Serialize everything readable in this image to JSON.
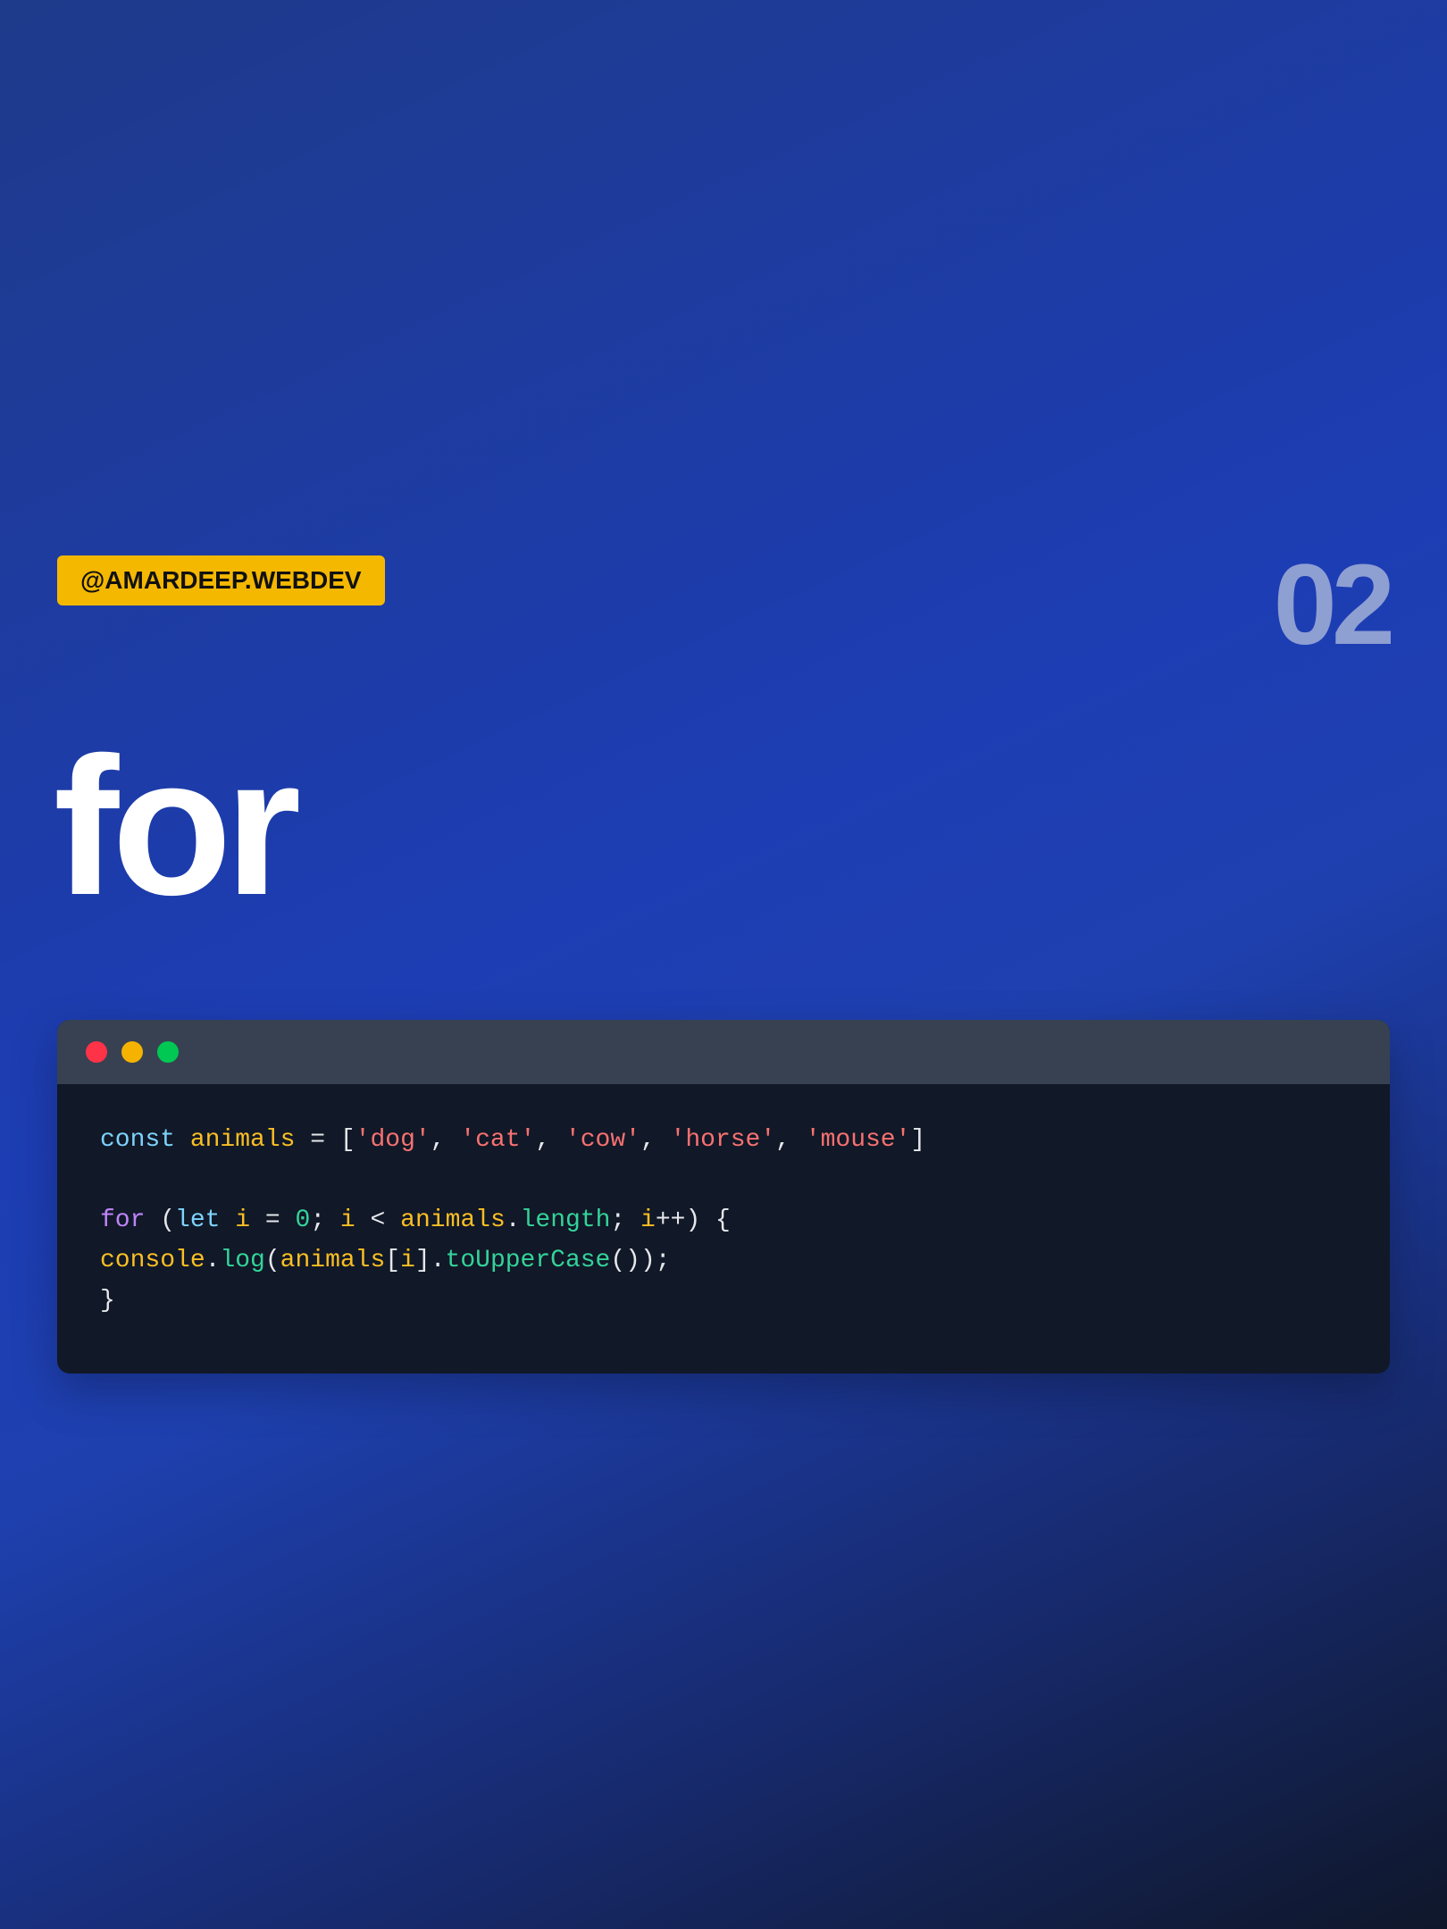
{
  "badge": {
    "label": "@AMARDEEP.WEBDEV"
  },
  "page_number": "02",
  "title": "for",
  "colors": {
    "badge_bg": "#f5b800",
    "page_number": "#8e9fd2",
    "window_titlebar": "#374151",
    "window_body": "#111827",
    "dot_close": "#ff3347",
    "dot_minimize": "#f5b300",
    "dot_maximize": "#00c853"
  },
  "window": {
    "dots": [
      {
        "name": "close",
        "color": "#ff3347"
      },
      {
        "name": "minimize",
        "color": "#f5b300"
      },
      {
        "name": "maximize",
        "color": "#00c853"
      }
    ]
  },
  "code": {
    "lines": [
      [
        {
          "t": "keyword-decl",
          "v": "const"
        },
        {
          "t": "plain",
          "v": " "
        },
        {
          "t": "var",
          "v": "animals"
        },
        {
          "t": "plain",
          "v": " = ["
        },
        {
          "t": "string",
          "v": "'dog'"
        },
        {
          "t": "plain",
          "v": ", "
        },
        {
          "t": "string",
          "v": "'cat'"
        },
        {
          "t": "plain",
          "v": ", "
        },
        {
          "t": "string",
          "v": "'cow'"
        },
        {
          "t": "plain",
          "v": ", "
        },
        {
          "t": "string",
          "v": "'horse'"
        },
        {
          "t": "plain",
          "v": ", "
        },
        {
          "t": "string",
          "v": "'mouse'"
        },
        {
          "t": "plain",
          "v": "]"
        }
      ],
      [],
      [
        {
          "t": "keyword-ctrl",
          "v": "for"
        },
        {
          "t": "plain",
          "v": " ("
        },
        {
          "t": "keyword-decl",
          "v": "let"
        },
        {
          "t": "plain",
          "v": " "
        },
        {
          "t": "var",
          "v": "i"
        },
        {
          "t": "plain",
          "v": " = "
        },
        {
          "t": "number",
          "v": "0"
        },
        {
          "t": "plain",
          "v": "; "
        },
        {
          "t": "var",
          "v": "i"
        },
        {
          "t": "plain",
          "v": " < "
        },
        {
          "t": "var",
          "v": "animals"
        },
        {
          "t": "plain",
          "v": "."
        },
        {
          "t": "prop",
          "v": "length"
        },
        {
          "t": "plain",
          "v": "; "
        },
        {
          "t": "var",
          "v": "i"
        },
        {
          "t": "plain",
          "v": "++) {"
        }
      ],
      [
        {
          "t": "var",
          "v": "console"
        },
        {
          "t": "plain",
          "v": "."
        },
        {
          "t": "prop",
          "v": "log"
        },
        {
          "t": "plain",
          "v": "("
        },
        {
          "t": "var",
          "v": "animals"
        },
        {
          "t": "plain",
          "v": "["
        },
        {
          "t": "var",
          "v": "i"
        },
        {
          "t": "plain",
          "v": "]."
        },
        {
          "t": "prop",
          "v": "toUpperCase"
        },
        {
          "t": "plain",
          "v": "());"
        }
      ],
      [
        {
          "t": "plain",
          "v": "}"
        }
      ]
    ]
  }
}
